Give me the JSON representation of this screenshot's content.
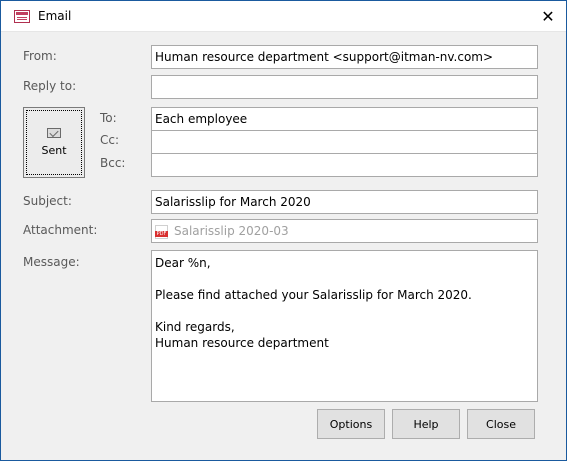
{
  "window": {
    "title": "Email",
    "close_glyph": "✕"
  },
  "form": {
    "from_label": "From:",
    "from_value": "Human resource department <support@itman-nv.com>",
    "reply_label": "Reply to:",
    "reply_value": "",
    "to_label": "To:",
    "to_value": "Each employee",
    "cc_label": "Cc:",
    "cc_value": "",
    "bcc_label": "Bcc:",
    "bcc_value": "",
    "subject_label": "Subject:",
    "subject_value": "Salarisslip for March 2020",
    "attachment_label": "Attachment:",
    "attachment_value": "Salarisslip 2020-03",
    "message_label": "Message:",
    "message_value": "Dear %n,\n\nPlease find attached your Salarisslip for March 2020.\n\nKind regards,\nHuman resource department"
  },
  "sent_button": {
    "label": "Sent",
    "icon": "envelope-icon"
  },
  "buttons": {
    "options": "Options",
    "help": "Help",
    "close": "Close"
  }
}
